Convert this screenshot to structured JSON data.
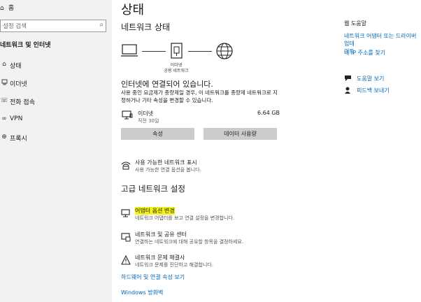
{
  "sidebar": {
    "home_label": "홈",
    "search_placeholder": "설정 검색",
    "section_heading": "네트워크 및 인터넷",
    "items": [
      {
        "label": "상태",
        "icon": "home-icon"
      },
      {
        "label": "이더넷",
        "icon": "ethernet-icon"
      },
      {
        "label": "전화 접속",
        "icon": "dialup-icon"
      },
      {
        "label": "VPN",
        "icon": "vpn-icon"
      },
      {
        "label": "프록시",
        "icon": "globe-icon"
      }
    ]
  },
  "main": {
    "title": "상태",
    "network_status_heading": "네트워크 상태",
    "diagram": {
      "device_caption": "이더넷",
      "device_caption2": "공용 네트워크"
    },
    "connected_text": "인터넷에 연결되어 있습니다.",
    "description": "사용 중인 요금제가 종량제일 경우, 이 네트워크를 종량제 네트워크로 지정하거나 기타 속성을 변경할 수 있습니다.",
    "connection": {
      "name": "이더넷",
      "subtitle": "직전 30일",
      "usage": "6.64 GB"
    },
    "buttons": {
      "properties": "속성",
      "data_usage": "데이터 사용량"
    },
    "show_networks": {
      "title": "사용 가능한 네트워크 표시",
      "desc": "사용 가능한 연결 옵션을 봅니다."
    },
    "advanced_heading": "고급 네트워크 설정",
    "adapter_options": {
      "title": "어댑터 옵션 변경",
      "desc": "네트워크 어댑터를 보고 연결 설정을 변경합니다."
    },
    "sharing_center": {
      "title": "네트워크 및 공유 센터",
      "desc": "연결하는 네트워크에 대해 공유할 항목을 결정하세요."
    },
    "troubleshooter": {
      "title": "네트워크 문제 해결사",
      "desc": "네트워크 문제를 진단하고 해결합니다."
    },
    "hardware_link": "하드웨어 및 연결 속성 보기",
    "firewall_link": "Windows 방화벽"
  },
  "right_panel": {
    "heading": "웹 도움말",
    "link1_line1": "네트워크 어댑터 또는 드라이버 업데",
    "link1_line2": "이트",
    "link2": "내 IP 주소를 찾기",
    "help_link": "도움말 보기",
    "feedback_link": "피드백 보내기"
  },
  "colors": {
    "accent": "#0067b8",
    "highlight": "#f5f215",
    "button_bg": "#cccccc",
    "sidebar_bg": "#f2f2f2"
  }
}
